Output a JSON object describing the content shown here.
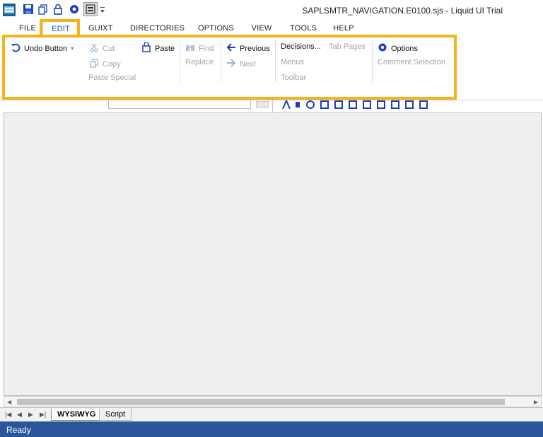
{
  "window": {
    "title": "SAPLSMTR_NAVIGATION.E0100.sjs - Liquid UI Trial"
  },
  "quick_access": {
    "icons": [
      "app-logo-icon",
      "save-icon",
      "copy-icon",
      "lock-icon",
      "gear-icon",
      "layout-icon",
      "dropdown-arrow-icon"
    ]
  },
  "tabs": [
    "FILE",
    "EDIT",
    "GUIXT",
    "DIRECTORIES",
    "OPTIONS",
    "VIEW",
    "TOOLS",
    "HELP"
  ],
  "active_tab": "EDIT",
  "ribbon": {
    "undo": "Undo Button",
    "cut": "Cut",
    "copy": "Copy",
    "paste": "Paste",
    "paste_special": "Paste Special",
    "find": "Find",
    "replace": "Replace",
    "previous": "Previous",
    "next": "Next",
    "decisions": "Decisions...",
    "tab_pages": "Tab Pages",
    "menus": "Menus",
    "toolbar": "Toolbar",
    "options": "Options",
    "comment_selection": "Comment Selection"
  },
  "sheets": [
    "WYSIWYG",
    "Script"
  ],
  "status": "Ready",
  "colors": {
    "accent": "#2b579a",
    "highlight": "#f5b21b",
    "disabled": "#a7a7a7"
  }
}
